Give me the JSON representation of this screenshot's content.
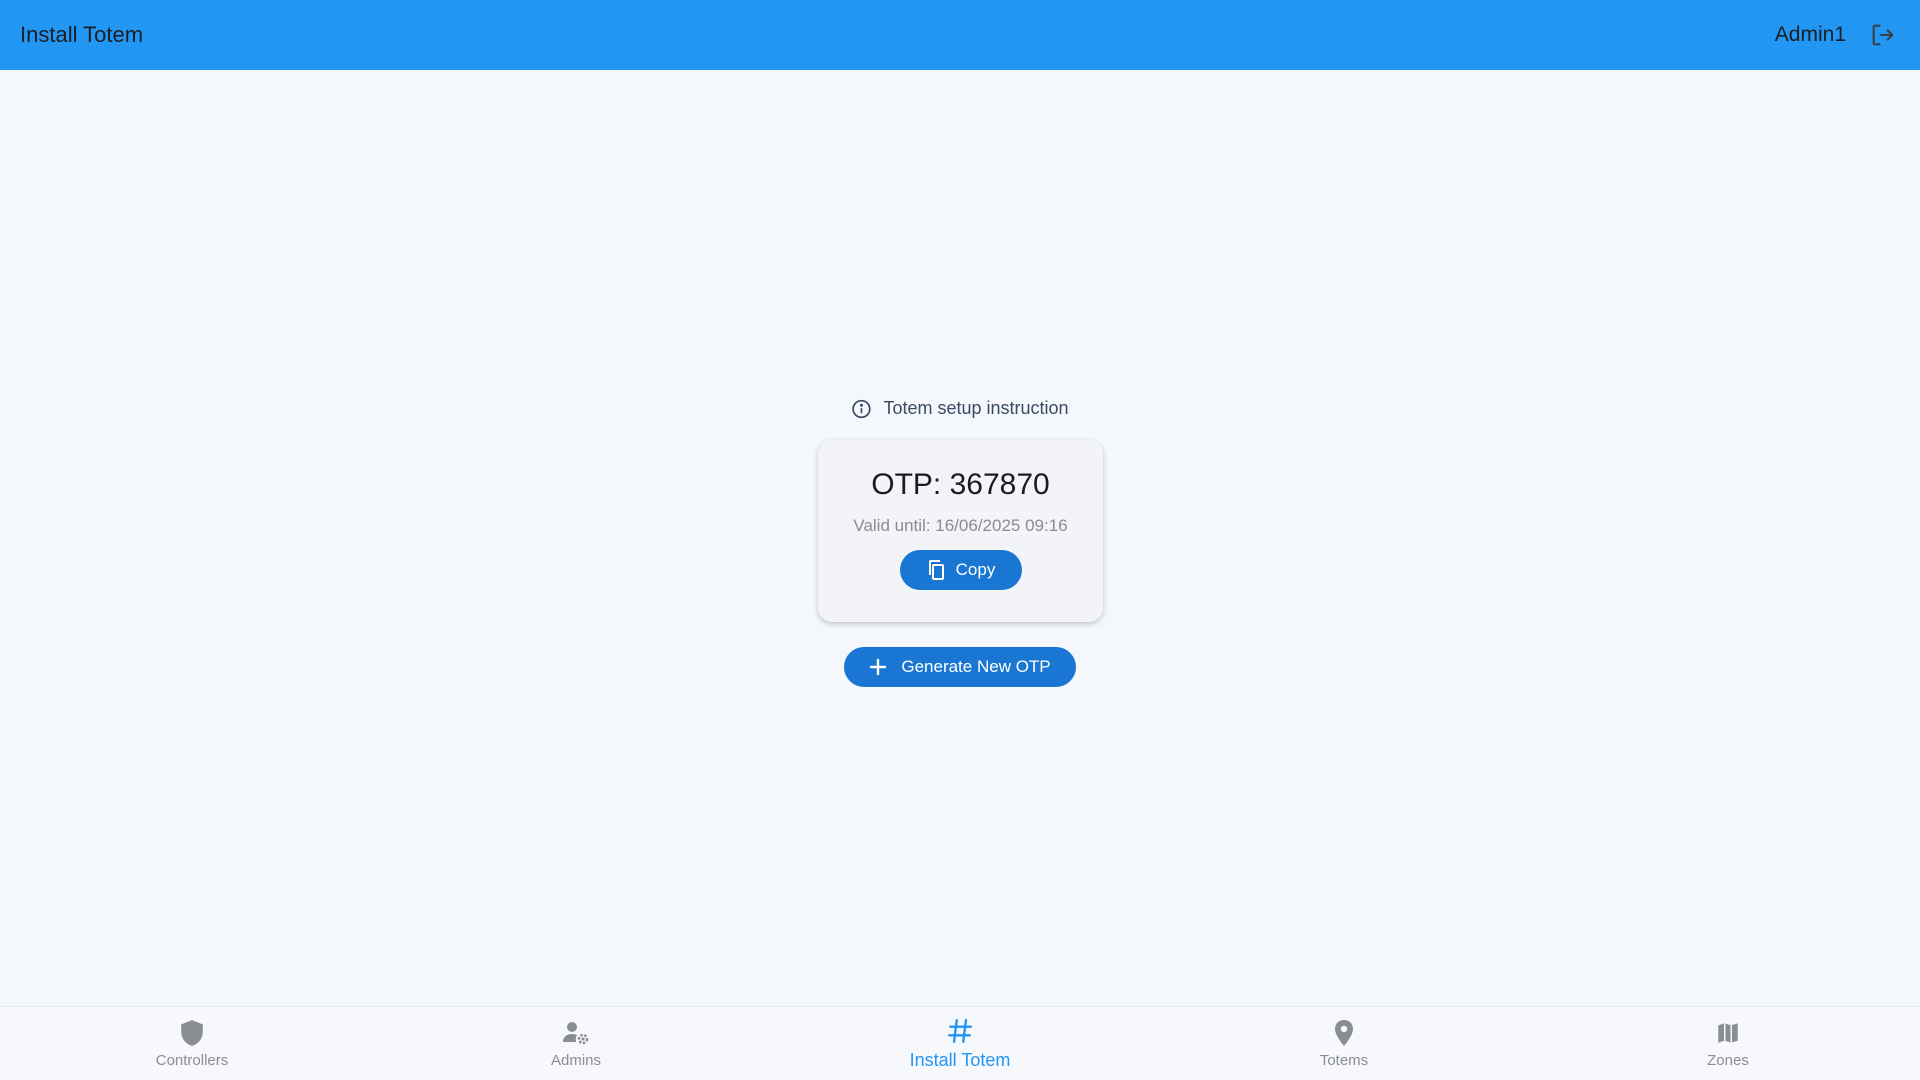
{
  "appbar": {
    "title": "Install Totem",
    "user_name": "Admin1",
    "background_color": "#2196f3",
    "logout_icon": "logout-icon"
  },
  "main": {
    "instruction_link": {
      "icon": "info-icon",
      "label": "Totem setup instruction"
    },
    "otp_card": {
      "otp_text": "OTP: 367870",
      "valid_until_text": "Valid until: 16/06/2025 09:16",
      "copy_button": {
        "icon": "copy-icon",
        "label": "Copy"
      }
    },
    "generate_button": {
      "icon": "plus-icon",
      "label": "Generate New OTP"
    },
    "accent_color": "#1976d2"
  },
  "bottom_nav": {
    "active_index": 2,
    "active_color": "#2196f3",
    "items": [
      {
        "label": "Controllers",
        "icon": "shield-icon"
      },
      {
        "label": "Admins",
        "icon": "admin-settings-icon"
      },
      {
        "label": "Install Totem",
        "icon": "hash-icon"
      },
      {
        "label": "Totems",
        "icon": "location-pin-icon"
      },
      {
        "label": "Zones",
        "icon": "map-icon"
      }
    ]
  }
}
